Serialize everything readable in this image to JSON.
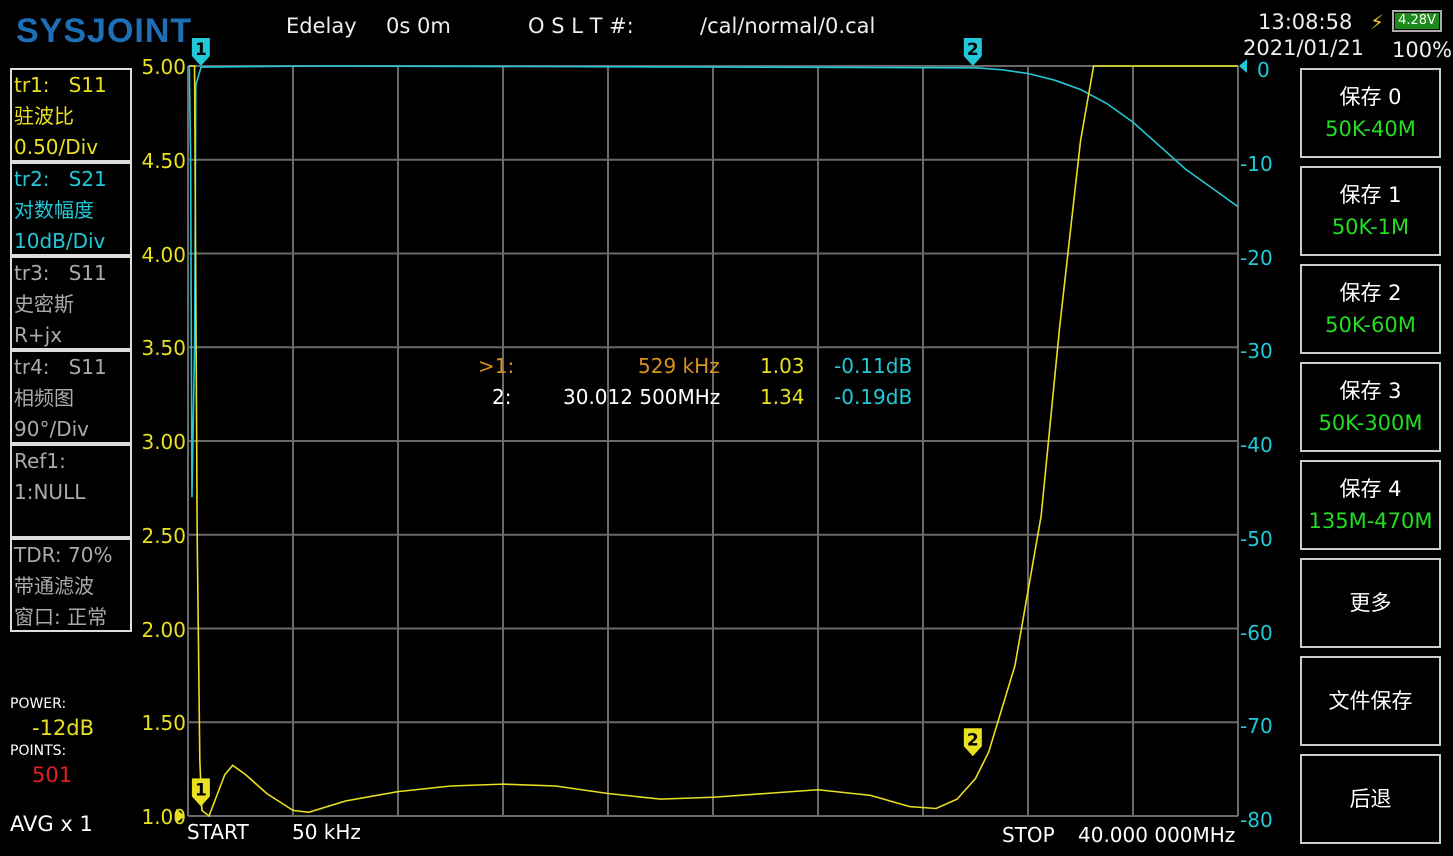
{
  "header": {
    "logo": "SYSJOINT",
    "edelay_label": "Edelay",
    "edelay_value": "0s 0m",
    "oslt_label": "O S L T #:",
    "cal_path": "/cal/normal/0.cal",
    "time": "13:08:58",
    "date": "2021/01/21",
    "battery_voltage": "4.28V",
    "battery_percent": "100%"
  },
  "traces": [
    {
      "line1": "tr1:   S11",
      "line2": "驻波比",
      "line3": "0.50/Div",
      "color": "#e8e020"
    },
    {
      "line1": "tr2:   S21",
      "line2": "对数幅度",
      "line3": "10dB/Div",
      "color": "#22c8d8"
    },
    {
      "line1": "tr3:   S11",
      "line2": "史密斯",
      "line3": "R+jx",
      "color": "#aaaaaa"
    },
    {
      "line1": "tr4:   S11",
      "line2": "相频图",
      "line3": "90°/Div",
      "color": "#aaaaaa"
    },
    {
      "line1": "Ref1:",
      "line2": "1:NULL",
      "line3": "",
      "color": "#aaaaaa"
    },
    {
      "line1": "TDR: 70%",
      "line2": "带通滤波",
      "line3": "窗口: 正常",
      "color": "#aaaaaa"
    }
  ],
  "status": {
    "power_label": "POWER:",
    "power_value": "-12dB",
    "points_label": "POINTS:",
    "points_value": "501",
    "avg": "AVG x 1"
  },
  "axis": {
    "left_ticks": [
      "5.00",
      "4.50",
      "4.00",
      "3.50",
      "3.00",
      "2.50",
      "2.00",
      "1.50",
      "1.00"
    ],
    "right_ticks": [
      "0",
      "-10",
      "-20",
      "-30",
      "-40",
      "-50",
      "-60",
      "-70",
      "-80"
    ],
    "start_label": "START",
    "start_value": "50 kHz",
    "stop_label": "STOP",
    "stop_value": "40.000 000MHz"
  },
  "markers": [
    {
      "id": "1",
      "prefix": ">1:",
      "freq": "529 kHz",
      "swr": "1.03",
      "db": "-0.11dB",
      "freq_mhz": 0.529
    },
    {
      "id": "2",
      "prefix": "2:",
      "freq": "30.012 500MHz",
      "swr": "1.34",
      "db": "-0.19dB",
      "freq_mhz": 30.0125
    }
  ],
  "buttons": [
    {
      "label": "保存 0",
      "sub": "50K-40M"
    },
    {
      "label": "保存 1",
      "sub": "50K-1M"
    },
    {
      "label": "保存 2",
      "sub": "50K-60M"
    },
    {
      "label": "保存 3",
      "sub": "50K-300M"
    },
    {
      "label": "保存 4",
      "sub": "135M-470M"
    },
    {
      "label": "更多",
      "sub": ""
    },
    {
      "label": "文件保存",
      "sub": ""
    },
    {
      "label": "后退",
      "sub": ""
    }
  ],
  "colors": {
    "swr": "#e8e020",
    "s21": "#22c8d8",
    "grid": "#6a6a6a"
  },
  "trace_swr_mhz_value": [
    [
      0.05,
      5
    ],
    [
      0.25,
      5
    ],
    [
      0.35,
      2.5
    ],
    [
      0.45,
      1.3
    ],
    [
      0.53,
      1.03
    ],
    [
      0.8,
      1.0
    ],
    [
      1.4,
      1.22
    ],
    [
      1.7,
      1.27
    ],
    [
      2.2,
      1.22
    ],
    [
      3.0,
      1.12
    ],
    [
      4.0,
      1.03
    ],
    [
      4.6,
      1.02
    ],
    [
      6,
      1.08
    ],
    [
      8,
      1.13
    ],
    [
      10,
      1.16
    ],
    [
      12,
      1.17
    ],
    [
      14,
      1.16
    ],
    [
      16,
      1.12
    ],
    [
      18,
      1.09
    ],
    [
      20,
      1.1
    ],
    [
      22,
      1.12
    ],
    [
      24,
      1.14
    ],
    [
      26,
      1.11
    ],
    [
      27.5,
      1.05
    ],
    [
      28.5,
      1.04
    ],
    [
      29.3,
      1.09
    ],
    [
      30.0,
      1.2
    ],
    [
      30.5,
      1.34
    ],
    [
      31.5,
      1.8
    ],
    [
      32.5,
      2.6
    ],
    [
      33.2,
      3.6
    ],
    [
      34.0,
      4.6
    ],
    [
      34.5,
      5
    ],
    [
      40,
      5
    ]
  ],
  "trace_s21_mhz_db": [
    [
      0.05,
      0
    ],
    [
      0.1,
      -10
    ],
    [
      0.15,
      -46
    ],
    [
      0.25,
      -30
    ],
    [
      0.3,
      -2
    ],
    [
      0.5,
      -0.11
    ],
    [
      5,
      0
    ],
    [
      30,
      -0.19
    ],
    [
      31,
      -0.4
    ],
    [
      32,
      -0.8
    ],
    [
      33,
      -1.5
    ],
    [
      34,
      -2.5
    ],
    [
      35,
      -4
    ],
    [
      36,
      -6
    ],
    [
      37,
      -8.5
    ],
    [
      38,
      -11
    ],
    [
      39,
      -13
    ],
    [
      40,
      -15
    ]
  ]
}
